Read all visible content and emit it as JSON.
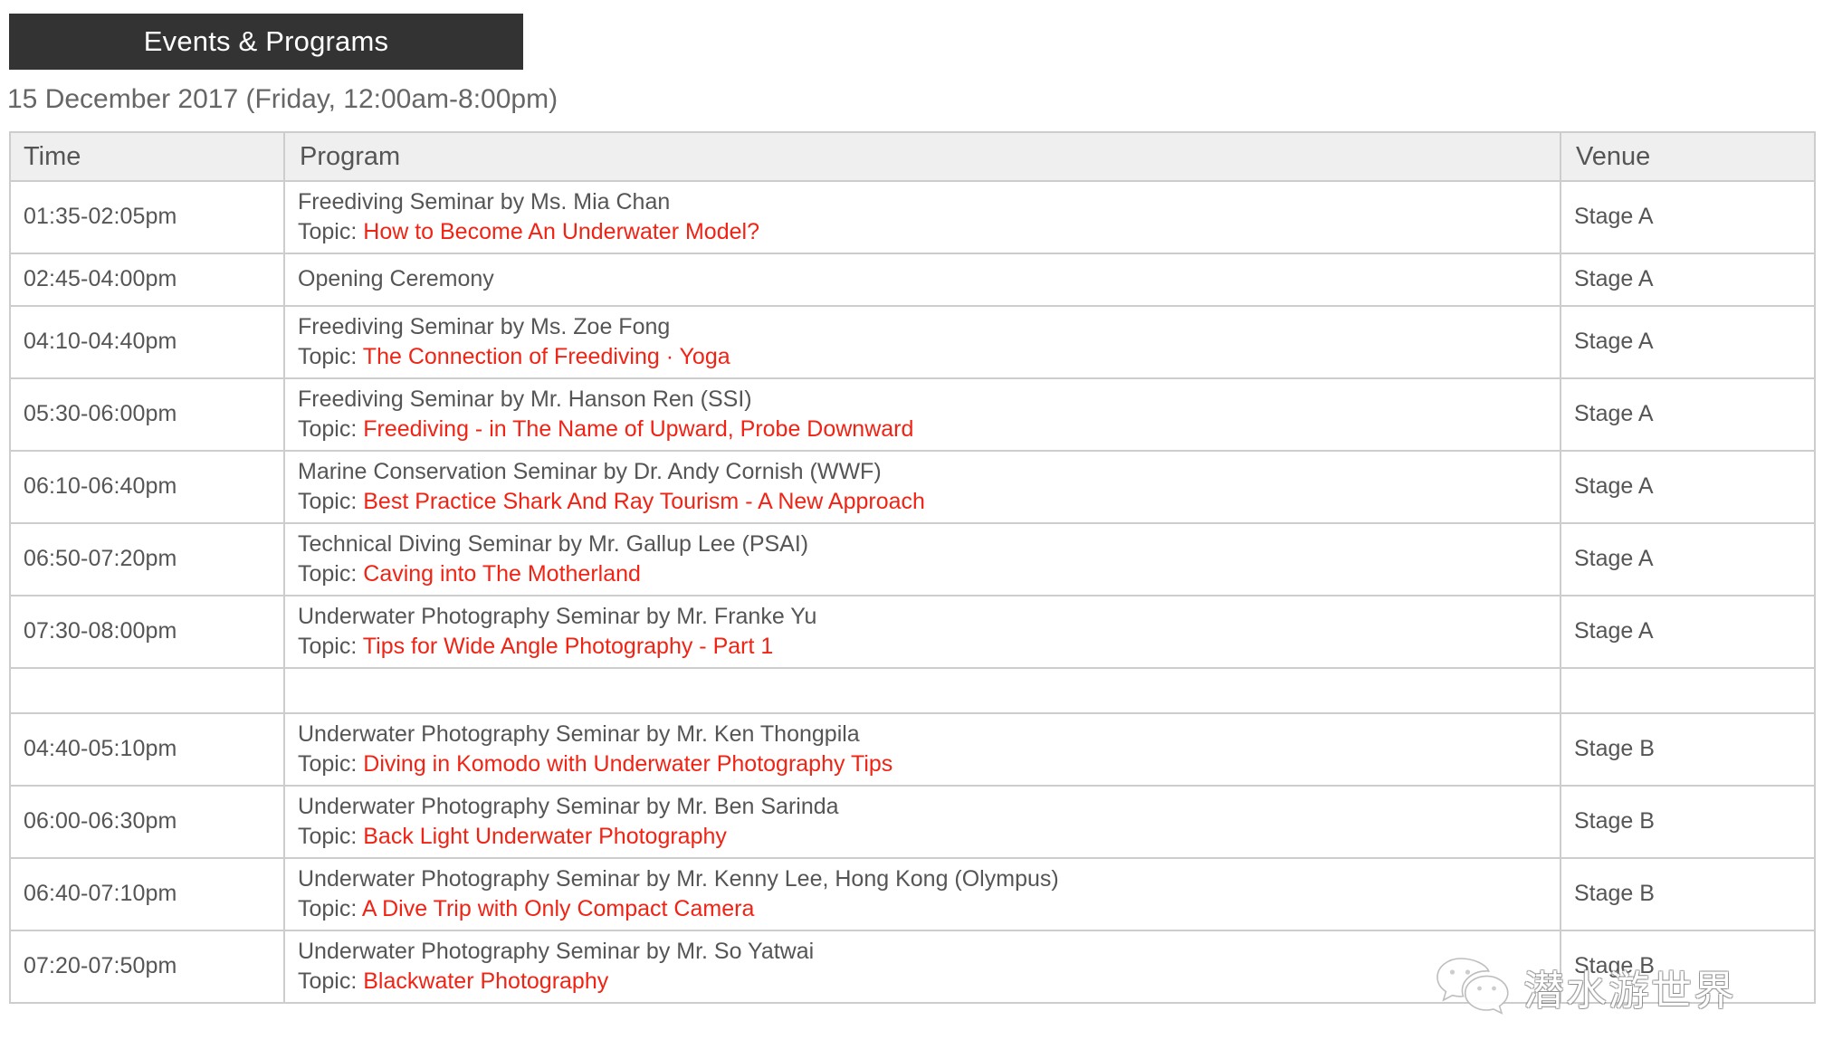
{
  "header": {
    "tab_title": "Events & Programs",
    "date_line": "15 December 2017 (Friday, 12:00am-8:00pm)"
  },
  "table": {
    "columns": {
      "time": "Time",
      "program": "Program",
      "venue": "Venue"
    },
    "topic_label": "Topic:",
    "rows": [
      {
        "time": "01:35-02:05pm",
        "program": "Freediving Seminar by Ms. Mia Chan",
        "topic": "How to Become An Underwater Model?",
        "venue": "Stage A",
        "shaded": false
      },
      {
        "time": "02:45-04:00pm",
        "program": "Opening Ceremony",
        "topic": "",
        "venue": "Stage A",
        "shaded": false
      },
      {
        "time": "04:10-04:40pm",
        "program": "Freediving Seminar by Ms. Zoe Fong",
        "topic": "The Connection of Freediving · Yoga",
        "venue": "Stage A",
        "shaded": false
      },
      {
        "time": "05:30-06:00pm",
        "program": "Freediving Seminar by Mr. Hanson Ren (SSI)",
        "topic": "Freediving - in The Name of Upward, Probe Downward",
        "venue": "Stage A",
        "shaded": false
      },
      {
        "time": "06:10-06:40pm",
        "program": "Marine Conservation Seminar by Dr. Andy Cornish (WWF)",
        "topic": "Best Practice Shark And Ray Tourism - A New Approach",
        "venue": "Stage A",
        "shaded": false
      },
      {
        "time": "06:50-07:20pm",
        "program": "Technical Diving Seminar by Mr. Gallup Lee (PSAI)",
        "topic": "Caving into The Motherland",
        "venue": "Stage A",
        "shaded": false
      },
      {
        "time": "07:30-08:00pm",
        "program": "Underwater Photography Seminar by Mr. Franke Yu",
        "topic": "Tips for Wide Angle Photography - Part 1",
        "venue": "Stage A",
        "shaded": false
      },
      {
        "time": "",
        "program": "",
        "topic": "",
        "venue": "",
        "shaded": false
      },
      {
        "time": "04:40-05:10pm",
        "program": "Underwater Photography Seminar by Mr. Ken Thongpila",
        "topic": "Diving in Komodo with Underwater Photography Tips",
        "venue": "Stage B",
        "shaded": true
      },
      {
        "time": "06:00-06:30pm",
        "program": "Underwater Photography Seminar by Mr. Ben Sarinda",
        "topic": "Back Light Underwater Photography",
        "venue": "Stage B",
        "shaded": true
      },
      {
        "time": "06:40-07:10pm",
        "program": "Underwater Photography Seminar by Mr. Kenny Lee, Hong Kong (Olympus)",
        "topic": "A Dive Trip with Only Compact Camera",
        "venue": "Stage B",
        "shaded": true
      },
      {
        "time": "07:20-07:50pm",
        "program": "Underwater Photography Seminar by Mr. So Yatwai",
        "topic": "Blackwater Photography",
        "venue": "Stage B",
        "shaded": true
      }
    ]
  },
  "watermark": {
    "text": "潜水游世界",
    "icon": "wechat-icon"
  },
  "colors": {
    "tab_background": "#333333",
    "topic_red": "#f02314",
    "header_row": "#efefef",
    "border": "#cdcdcd",
    "shaded_row": "#f5f5f5",
    "body_text": "#555555"
  }
}
